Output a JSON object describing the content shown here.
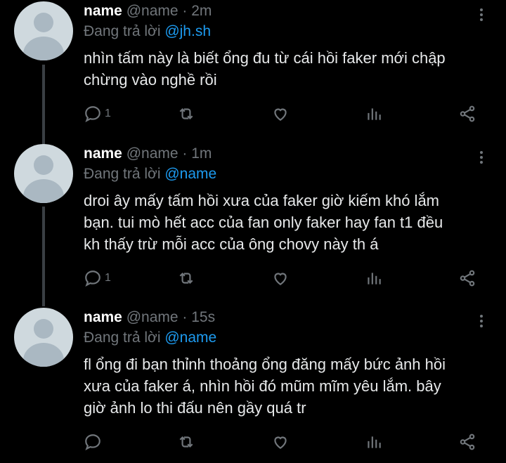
{
  "tweets": [
    {
      "name": "name",
      "handle": "@name",
      "separator": "·",
      "time": "2m",
      "reply_prefix": "Đang trả lời",
      "reply_to": "@jh.sh",
      "text_lines": [
        "nhìn tấm này là biết ổng đu từ cái hồi faker mới chập",
        "chừng vào nghề rồi"
      ],
      "reply_count": "1"
    },
    {
      "name": "name",
      "handle": "@name",
      "separator": "·",
      "time": "1m",
      "reply_prefix": "Đang trả lời",
      "reply_to": "@name",
      "text_lines": [
        "droi ây mấy tấm hồi xưa của faker giờ kiếm khó lắm",
        "bạn. tui mò hết acc của fan only faker hay fan t1 đều",
        "kh thấy trừ mỗi acc của ông chovy này th á"
      ],
      "reply_count": "1"
    },
    {
      "name": "name",
      "handle": "@name",
      "separator": "·",
      "time": "15s",
      "reply_prefix": "Đang trả lời",
      "reply_to": "@name",
      "text_lines": [
        "fl ổng đi bạn thỉnh thoảng ổng đăng mấy bức ảnh hồi",
        "xưa của faker á, nhìn hồi đó mũm mĩm yêu lắm. bây",
        "giờ ảnh lo thi đấu nên gầy quá tr"
      ],
      "reply_count": ""
    }
  ],
  "icons": {
    "reply": "reply-icon",
    "retweet": "retweet-icon",
    "like": "heart-icon",
    "views": "analytics-icon",
    "share": "share-icon",
    "more": "more-options-icon"
  },
  "colors": {
    "background": "#000000",
    "text": "#e7e9ea",
    "muted": "#71767b",
    "accent": "#1d9bf0",
    "thread_line": "#3a3f44",
    "avatar_bg": "#cfd9de"
  }
}
